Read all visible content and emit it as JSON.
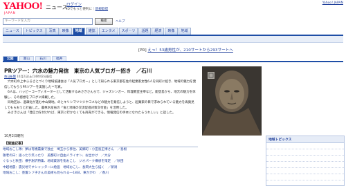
{
  "header": {
    "logo_text": "YAHOO!",
    "logo_sub": "JAPAN",
    "site_name": "ニュース",
    "login_label": "ログイン",
    "welcome_text": "IDでもっと便利に",
    "register_label": "新規取得",
    "top_link": "Yahoo! JAPAN"
  },
  "search": {
    "placeholder": "キーワードを入力",
    "button_label": "検索",
    "help_label": "ヘルプ"
  },
  "nav": {
    "tabs": [
      "ニュース",
      "トピックス",
      "写真",
      "映像",
      "地域",
      "雑誌",
      "エンタメ",
      "スポーツ",
      "話題",
      "経済",
      "映像",
      "地域"
    ],
    "active_index": 4
  },
  "pr": {
    "prefix": "[PR]",
    "text": "えっ！53歳男性が、210サートから293サートへ"
  },
  "local_tabs": {
    "items": [
      "北陸",
      "富山",
      "石川",
      "福井"
    ],
    "active_index": 0
  },
  "article": {
    "headline": "PRツアー：穴水の魅力発信　東京の人気ブロガー招き　／石川",
    "source": "毎日新聞",
    "byline_rest": "10月2日(土)14時42分配信",
    "paragraphs": [
      "穴水町の上中ふるさとづくり地域協議会は「人気ブロガー」として知られる東京都在住の起業家女性6人を同町に招き、地域の魅力を発信してもらうPRツアーを実施した＝写真。",
      "6人は、ハッピーコーディネーターとして活動するみさきさんらで、ジャズシンガー、料理教室主宰など。能登島から、地元の魅力を体験し、その感想をブログに掲載した。",
      "同地区は、過疎化が進む中山間地。のとキリシマツツジやコメなどの魅力を発信しようと、起業家の目で求められている魅力を再発見してもらおうと計画した。農林水産省の「食と地域の交流促進対策交付金」を活用した。",
      "みさきさんは「発信力を付ければ、東京に行かなくても商売ができる。情報発信の手本になれたらうれしい」と話した。"
    ],
    "date": "10月2日朝刊"
  },
  "related": {
    "title": "【関連記事】",
    "items": [
      "地域おこし隊：夢は有機農業で独立　埼玉から移住、美郷町・小田島正博さん　／島根",
      "敬老の日：語ったり笑ったり　美都町に自由人ライオン、お出かけ　／大分",
      "ぐるっと秋田：横手謝沢特集、地域資源を街おこし　ジオパーク構想を策定　／秋田",
      "中越地震：震災地ですシャッターに絵画　地域おこし、長岡大生ら描く　／新潟",
      "地域おこし：芸置シゾ子さんの美術も見られる―18日、東かがわ　／香川"
    ]
  },
  "sidebar": {
    "title": "地域トピックス"
  }
}
